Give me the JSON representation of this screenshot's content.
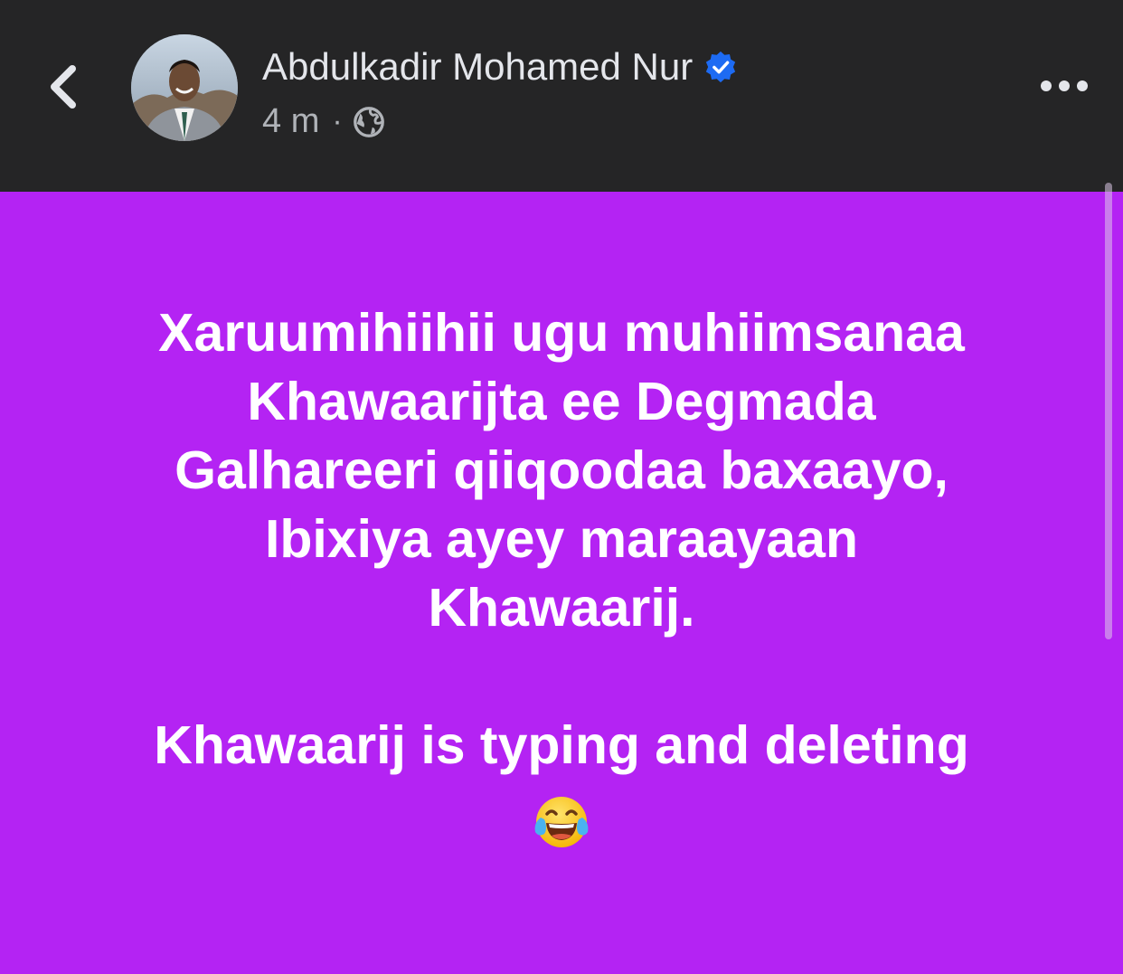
{
  "header": {
    "author_name": "Abdulkadir Mohamed Nur",
    "timestamp": "4 m",
    "separator": "·",
    "privacy_icon": "globe-icon",
    "back_icon": "chevron-left-icon",
    "more_icon": "more-horizontal-icon",
    "verified": true
  },
  "post": {
    "background_color": "#b423f3",
    "lines": [
      "Xaruumihiihii ugu muhiimsanaa",
      "Khawaarijta ee Degmada",
      "Galhareeri qiiqoodaa baxaayo,",
      "Ibixiya ayey maraayaan",
      "Khawaarij.",
      "",
      "Khawaarij is typing and deleting"
    ],
    "emoji": "😂"
  },
  "colors": {
    "header_bg": "#252526",
    "name_text": "#e4e6eb",
    "meta_text": "#b0b3b8",
    "verified_blue": "#1d6bf3"
  }
}
